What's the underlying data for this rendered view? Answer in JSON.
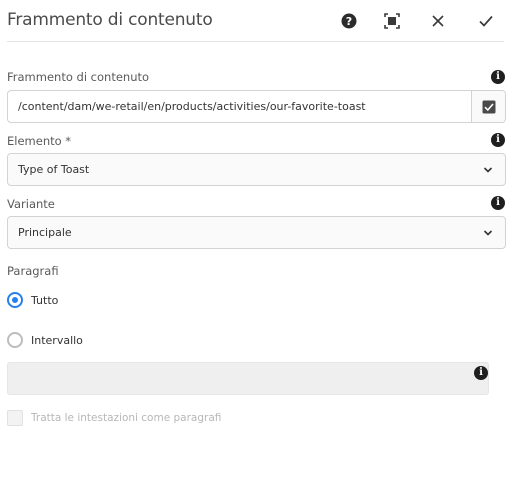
{
  "dialog": {
    "title": "Frammento di contenuto",
    "buttons": {
      "help": "help-icon",
      "fullscreen": "fullscreen-icon",
      "close": "close-icon",
      "done": "checkmark-icon"
    }
  },
  "fragment": {
    "label": "Frammento di contenuto",
    "value": "/content/dam/we-retail/en/products/activities/our-favorite-toast",
    "browse_icon": "checkbox-browse-icon"
  },
  "element": {
    "label": "Elemento *",
    "value": "Type of Toast"
  },
  "variation": {
    "label": "Variante",
    "value": "Principale"
  },
  "paragraphs": {
    "label": "Paragrafi",
    "options": [
      {
        "label": "Tutto",
        "checked": true
      },
      {
        "label": "Intervallo",
        "checked": false
      }
    ],
    "range_value": ""
  },
  "headings": {
    "label": "Tratta le intestazioni come paragrafi",
    "checked": false,
    "disabled": true
  },
  "colors": {
    "accent": "#2680eb",
    "info": "#1f1f1f"
  }
}
